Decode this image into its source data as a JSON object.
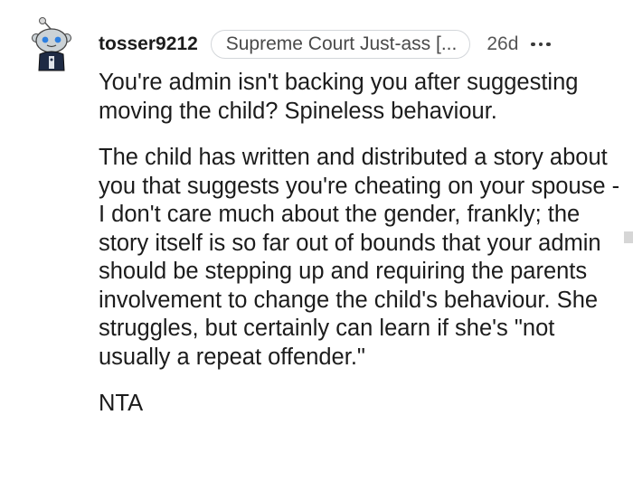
{
  "comment": {
    "username": "tosser9212",
    "flair": "Supreme Court Just-ass [...",
    "timestamp": "26d",
    "avatar_icon": "snoo-avatar-icon",
    "more_icon": "more-options-icon",
    "paragraphs": [
      "You're admin isn't backing you after suggesting moving the child? Spineless behaviour.",
      "The child has written and distributed a story about you that suggests you're cheating on your spouse - I don't care much about the gender, frankly; the story itself is so far out of bounds that your admin should be stepping up and requiring the parents involvement to change the child's behaviour. She struggles, but certainly can learn if she's \"not usually a repeat offender.\"",
      "NTA"
    ]
  },
  "colors": {
    "text": "#1c1c1c",
    "muted": "#555555",
    "flair_border": "#d3d6da",
    "avatar_face": "#cbd2d6",
    "avatar_eyes": "#2d7fe0",
    "avatar_body": "#1e2a44"
  }
}
